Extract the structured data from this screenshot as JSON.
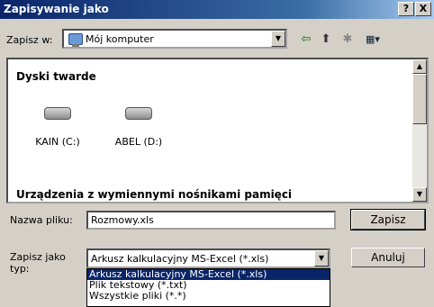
{
  "window": {
    "title": "Zapisywanie jako",
    "help_label": "?",
    "close_label": "X"
  },
  "lookin": {
    "label": "Zapisz w:",
    "value": "Mój komputer",
    "icon": "computer-icon"
  },
  "toolbar": {
    "back_icon": "back-arrow-icon",
    "up_icon": "up-folder-icon",
    "new_folder_icon": "new-folder-icon",
    "views_icon": "views-menu-icon"
  },
  "filelist": {
    "section1_title": "Dyski twarde",
    "drives": [
      {
        "label": "KAIN (C:)"
      },
      {
        "label": "ABEL (D:)"
      }
    ],
    "section2_title": "Urządzenia z wymiennymi nośnikami pamięci"
  },
  "filename": {
    "label": "Nazwa pliku:",
    "value": "Rozmowy.xls"
  },
  "filetype": {
    "label": "Zapisz jako typ:",
    "value": "Arkusz kalkulacyjny MS-Excel (*.xls)",
    "options": [
      "Arkusz kalkulacyjny MS-Excel (*.xls)",
      "Plik tekstowy (*.txt)",
      "Wszystkie pliki (*.*)"
    ]
  },
  "buttons": {
    "save": "Zapisz",
    "cancel": "Anuluj"
  },
  "colors": {
    "titlebar": "#0a246a",
    "selection": "#0a246a",
    "face": "#d4d0c8"
  }
}
